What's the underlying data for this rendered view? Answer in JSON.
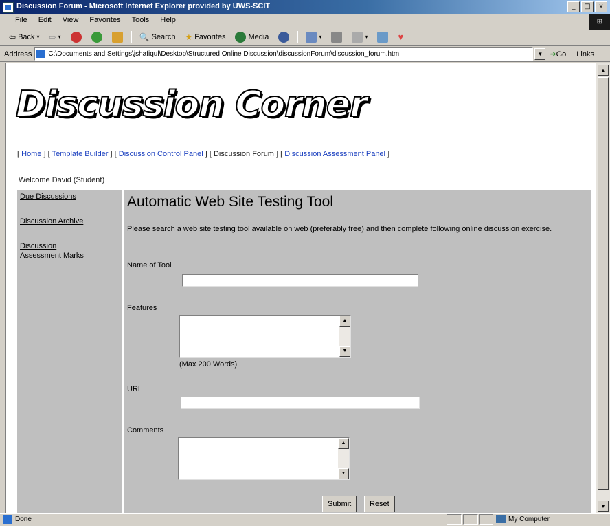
{
  "window": {
    "title": "Discussion Forum - Microsoft Internet Explorer provided by UWS-SCIT",
    "controls": [
      "_",
      "□",
      "x"
    ]
  },
  "menu": [
    "File",
    "Edit",
    "View",
    "Favorites",
    "Tools",
    "Help"
  ],
  "toolbar": {
    "back": "Back",
    "search": "Search",
    "favorites": "Favorites",
    "media": "Media"
  },
  "addressbar": {
    "label": "Address",
    "url": "C:\\Documents and Settings\\jshafiqul\\Desktop\\Structured Online Discussion\\discussionForum\\discussion_forum.htm",
    "go": "Go",
    "links": "Links"
  },
  "page": {
    "logo": "Discussion Corner",
    "nav": {
      "home": "Home",
      "template_builder": "Template Builder",
      "control_panel": "Discussion Control Panel",
      "forum": "Discussion Forum",
      "assessment_panel": "Discussion Assessment Panel"
    },
    "welcome": "Welcome David (Student)",
    "sidebar": [
      "Due Discussions",
      "Discussion Archive",
      "Discussion Assessment Marks"
    ],
    "heading": "Automatic Web Site Testing Tool",
    "intro": "Please search a web site testing tool available on web (preferably free) and then complete following online discussion exercise.",
    "form": {
      "name_label": "Name  of Tool",
      "features_label": "Features",
      "features_note": "(Max 200 Words)",
      "url_label": "URL",
      "comments_label": "Comments",
      "submit": "Submit",
      "reset": "Reset"
    }
  },
  "status": {
    "text": "Done",
    "zone": "My Computer"
  }
}
